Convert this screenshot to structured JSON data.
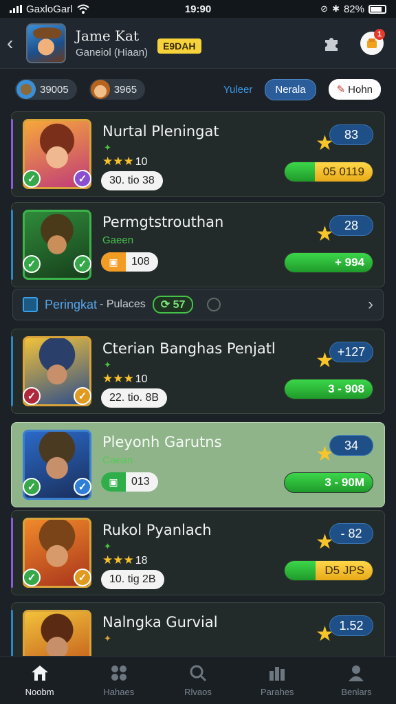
{
  "status_bar": {
    "carrier": "GaxloGarl",
    "time": "19:90",
    "battery": "82%"
  },
  "header": {
    "title": "Jame Kat",
    "subtitle": "Ganeiol (Hiaan)",
    "badge": "E9DAH",
    "notification_count": "1"
  },
  "filters": {
    "pill_1_value": "39005",
    "pill_2_value": "3965",
    "label": "Yuleer",
    "tab_active": "Nerala",
    "tab_secondary": "Hohn"
  },
  "cards": [
    {
      "title": "Nurtal Pleningat",
      "stars_count": 10,
      "chip": "30. tio 38",
      "score": "83",
      "bar_value": "05 0119",
      "bar_fill": 0.34,
      "bar_style": "yellow"
    },
    {
      "title": "Permgtstrouthan",
      "sub": "Gaeen",
      "chip": "108",
      "score": "28",
      "bar_value": "+ 994",
      "bar_fill": 1.0,
      "bar_style": "green"
    },
    {
      "title": "Cterian Banghas Penjatl",
      "stars_count": 10,
      "chip": "22. tio. 8B",
      "score": "+127",
      "bar_value": "3 - 908",
      "bar_fill": 1.0,
      "bar_style": "green"
    },
    {
      "title": "Pleyonh Garutns",
      "sub": "Caean",
      "chip": "013",
      "score": "34",
      "bar_value": "3 - 90M",
      "bar_fill": 1.0,
      "bar_style": "green"
    },
    {
      "title": "Rukol Pyanlach",
      "stars_count": 18,
      "chip": "10. tig 2B",
      "score": "- 82",
      "bar_value": "D5 JPS",
      "bar_fill": 0.35,
      "bar_style": "yellow"
    },
    {
      "title": "Nalngka Gurvial",
      "score": "1.52",
      "bar_value": "",
      "bar_fill": 1.0,
      "bar_style": "green"
    }
  ],
  "ranking_banner": {
    "label": "Peringkat",
    "label2": "- Pulaces",
    "count": "57"
  },
  "bottom_nav": [
    {
      "label": "Noobm"
    },
    {
      "label": "Hahaes"
    },
    {
      "label": "Rlvaos"
    },
    {
      "label": "Parahes"
    },
    {
      "label": "Benlars"
    }
  ],
  "colors": {
    "accent_blue": "#2a5d9a",
    "green": "#3cd64a",
    "yellow": "#f6d23b",
    "highlight_card": "#8fb48a"
  }
}
